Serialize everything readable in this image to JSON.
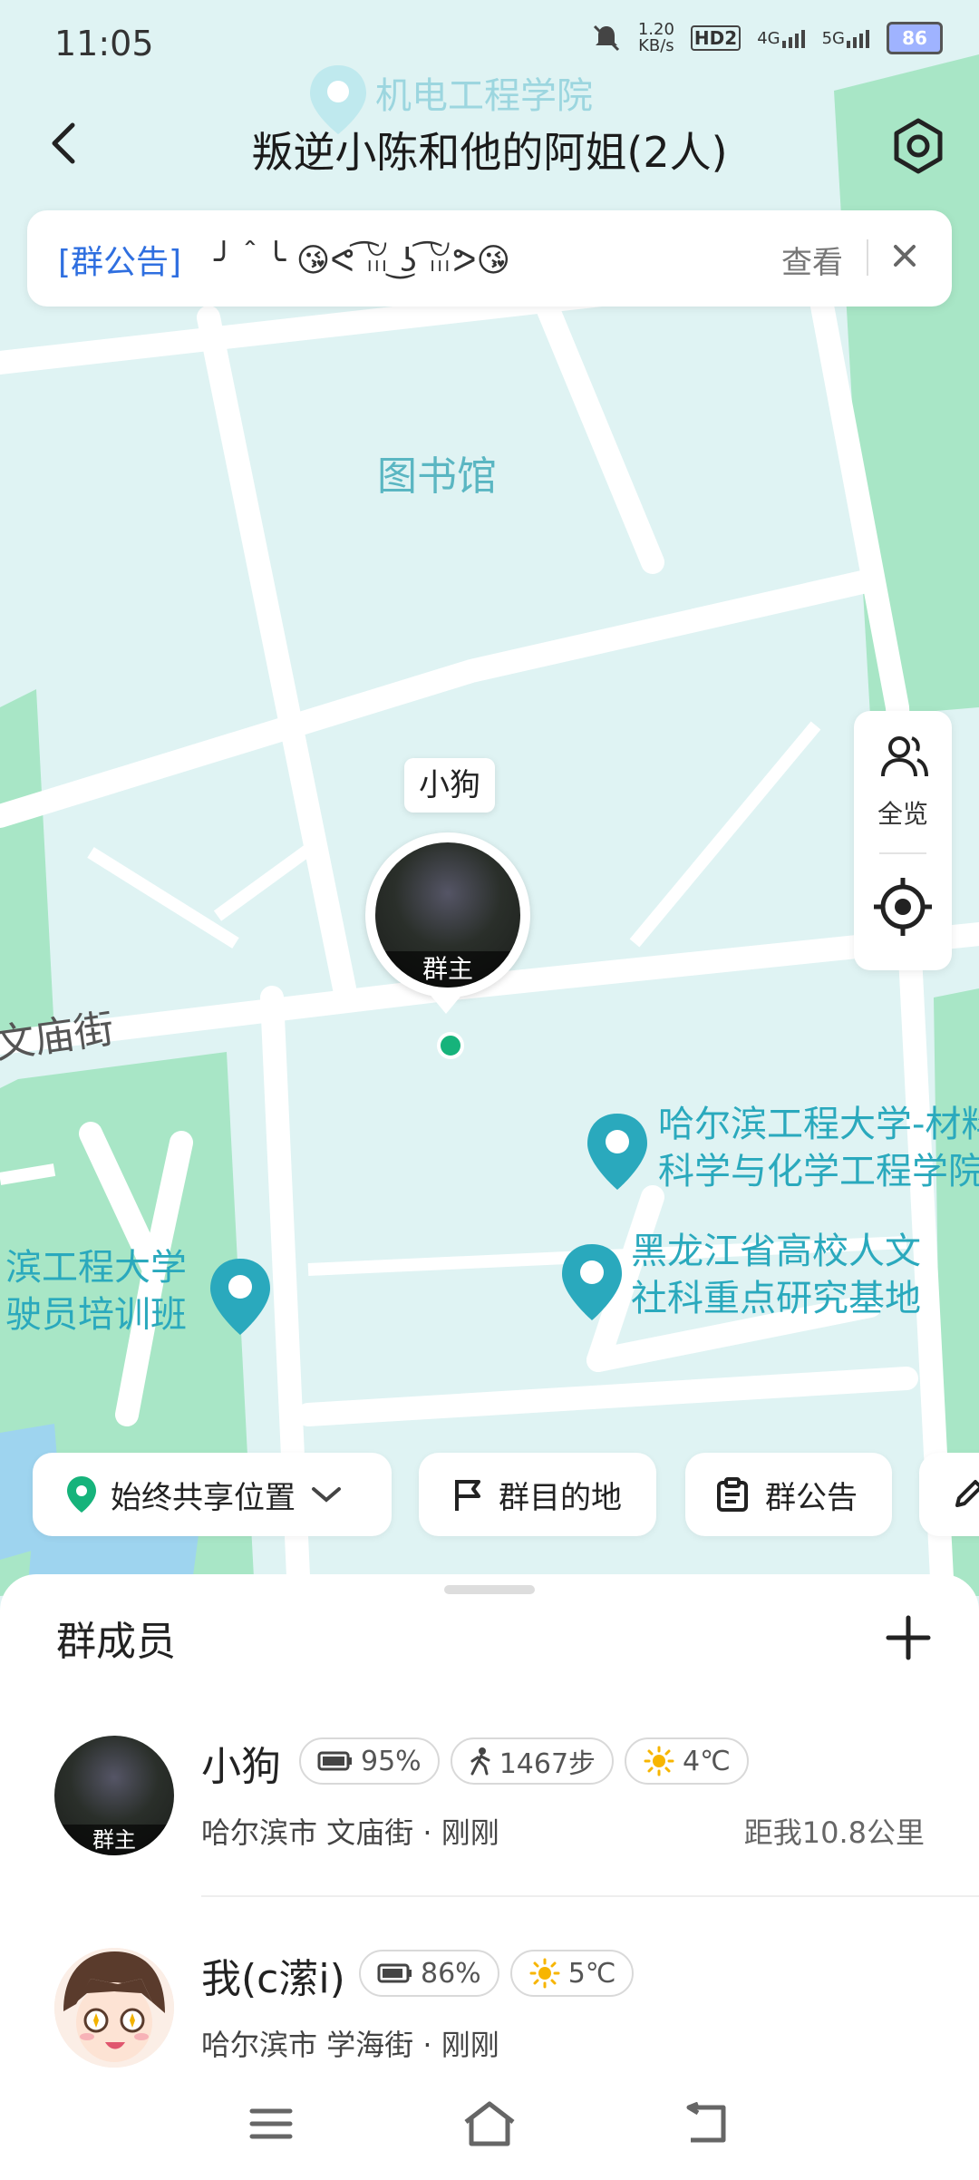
{
  "status_bar": {
    "time": "11:05",
    "net_speed": "1.20\nKB/s",
    "hd_badge": "HD2",
    "net_4g": "4G",
    "net_5g": "5G",
    "battery": "86"
  },
  "header": {
    "title": "叛逆小陈和他的阿姐(2人)",
    "back_icon": "back-arrow-icon",
    "settings_icon": "settings-hex-icon"
  },
  "notice": {
    "tag": "[群公告]",
    "text": "╯＾╰ 😘ᕙ ͡ꈍ ͜ʖ ͡ꈍᕗ😘",
    "view": "查看"
  },
  "map": {
    "labels": {
      "school": "机电工程学院",
      "library": "图书馆",
      "street": "文庙街",
      "poi1": "哈尔滨工程大学-材料\n科学与化学工程学院",
      "poi2": "黑龙江省高校人文\n社科重点研究基地",
      "poi3": "滨工程大学\n驶员培训班"
    },
    "marker": {
      "name": "小狗",
      "role": "群主"
    }
  },
  "side_panel": {
    "overview": "全览"
  },
  "actions": {
    "share_location": "始终共享位置",
    "destination": "群目的地",
    "announcement": "群公告"
  },
  "members": {
    "title": "群成员",
    "list": [
      {
        "name": "小狗",
        "role": "群主",
        "battery": "95%",
        "steps": "1467步",
        "weather": "4℃",
        "location": "哈尔滨市 文庙街 · 刚刚",
        "distance": "距我10.8公里"
      },
      {
        "name": "我(c潆i)",
        "battery": "86%",
        "weather": "5℃",
        "location": "哈尔滨市 学海街 · 刚刚"
      }
    ]
  },
  "colors": {
    "accent_green": "#16b37b",
    "map_bg": "#dff3f3",
    "park_green": "#a8e6c6",
    "poi_teal": "#2aa9bd",
    "notice_blue": "#2f6fe0"
  }
}
